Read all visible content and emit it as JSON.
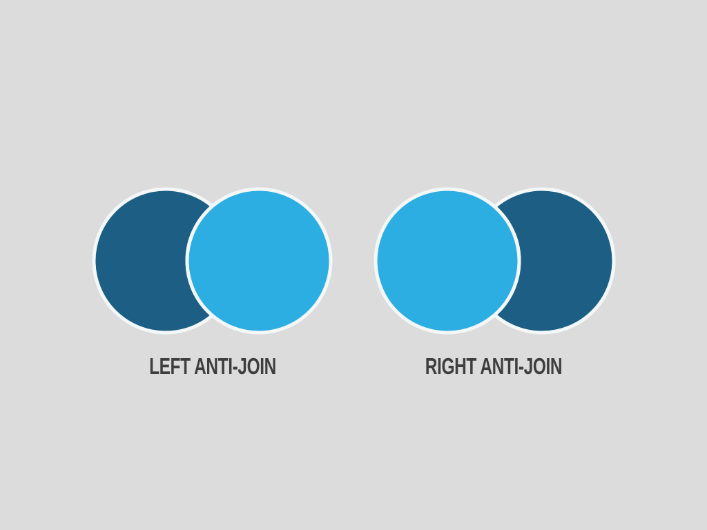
{
  "colors": {
    "background": "#dcdcdc",
    "selected_region": "#1c5e84",
    "unselected_region": "#2daee2",
    "outline": "#f4f7f8",
    "caption_text": "#3e3e3e"
  },
  "diagrams": [
    {
      "label": "LEFT ANTI-JOIN",
      "highlighted_region": "left-only"
    },
    {
      "label": "RIGHT ANTI-JOIN",
      "highlighted_region": "right-only"
    }
  ]
}
